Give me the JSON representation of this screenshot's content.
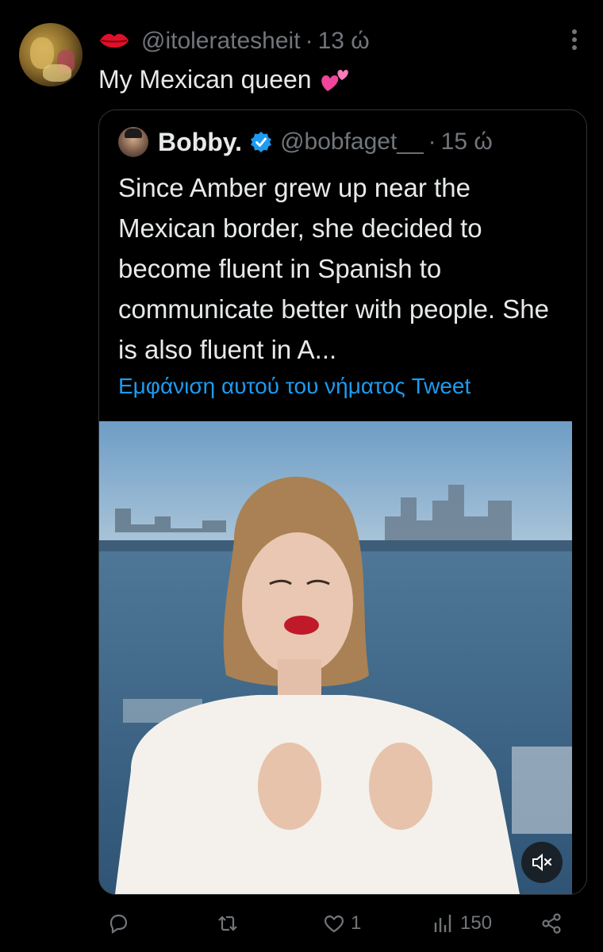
{
  "tweet": {
    "handle": "@itoleratesheit",
    "time": "13 ώ",
    "separator": "·",
    "text": "My Mexican queen",
    "icons": {
      "name_emoji": "lips-icon",
      "text_emoji": "two-hearts-icon",
      "more": "more-vertical-icon"
    }
  },
  "quote": {
    "name": "Bobby.",
    "handle": "@bobfaget__",
    "separator": "·",
    "time": "15 ώ",
    "text": "Since Amber grew up near the Mexican border, she decided to become fluent in Spanish to communicate better with people. She is also fluent in A...",
    "show_thread_label": "Εμφάνιση αυτού του νήματος Tweet",
    "verified_color": "#1d9bf0",
    "media": {
      "type": "video",
      "mute_icon": "muted-speaker-icon"
    }
  },
  "actions": {
    "reply_count": "",
    "retweet_count": "",
    "like_count": "1",
    "views_count": "150",
    "icons": [
      "reply-icon",
      "retweet-icon",
      "like-icon",
      "views-icon",
      "share-icon"
    ]
  },
  "colors": {
    "background": "#000000",
    "text": "#e7e9ea",
    "muted": "#71767b",
    "link": "#1d9bf0",
    "border": "#2f3336"
  }
}
